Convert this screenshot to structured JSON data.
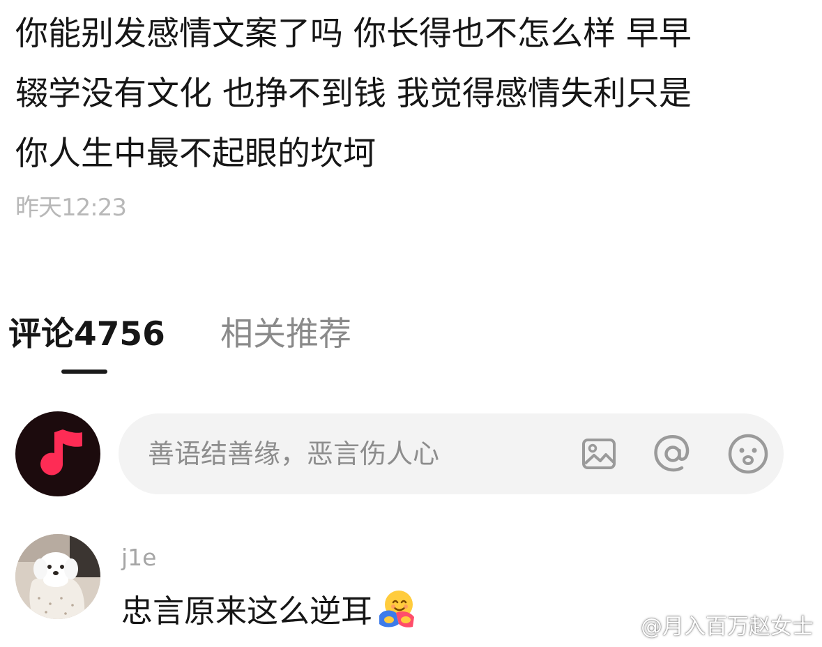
{
  "post": {
    "lines": [
      "你能别发感情文案了吗 你长得也不怎么样 早早",
      "辍学没有文化 也挣不到钱 我觉得感情失利只是",
      "你人生中最不起眼的坎坷"
    ],
    "timestamp": "昨天12:23"
  },
  "tabs": {
    "comments_label": "评论4756",
    "related_label": "相关推荐",
    "active": "comments"
  },
  "comment_box": {
    "placeholder": "善语结善缘，恶言伤人心",
    "icons": [
      "image-icon",
      "at-icon",
      "emoji-icon"
    ]
  },
  "comments": [
    {
      "username": "j1e",
      "text": "忠言原来这么逆耳",
      "emoji": "hugging-face-emoji"
    }
  ],
  "watermark": {
    "text": "@月入百万赵女士",
    "logo": "weibo-logo"
  },
  "colors": {
    "brand_accent": "#fe2c55",
    "self_avatar_bg": "#1c0b0d",
    "muted_text": "#a6a6a6",
    "input_bg": "#f3f3f3"
  }
}
